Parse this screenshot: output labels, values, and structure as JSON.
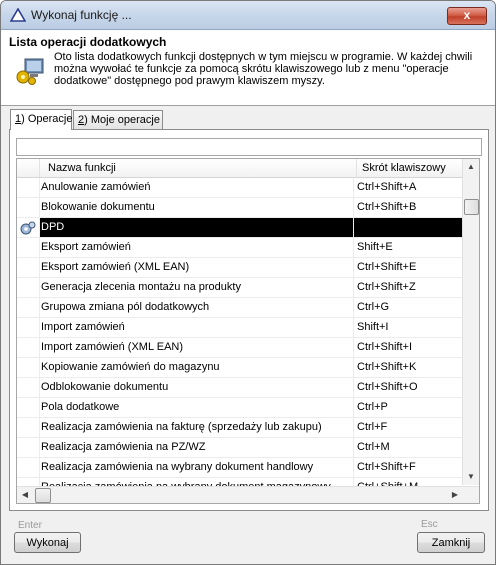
{
  "window": {
    "title": "Wykonaj funkcję ...",
    "close_label": "x"
  },
  "header": {
    "title": "Lista operacji dodatkowych",
    "description": "Oto lista dodatkowych funkcji dostępnych w tym miejscu w programie. W każdej chwili można wywołać te funkcje za pomocą skrótu klawiszowego lub z menu \"operacje dodatkowe\" dostępnego pod prawym klawiszem myszy."
  },
  "tabs": [
    {
      "hotkey": "1",
      "label": ") Operacje"
    },
    {
      "hotkey": "2",
      "label": ") Moje operacje"
    }
  ],
  "grid": {
    "columns": [
      "Nazwa funkcji",
      "Skrót klawiszowy"
    ],
    "rows": [
      {
        "name": "Anulowanie zamówień",
        "key": "Ctrl+Shift+A"
      },
      {
        "name": "Blokowanie dokumentu",
        "key": "Ctrl+Shift+B"
      },
      {
        "name": "DPD",
        "key": ""
      },
      {
        "name": "Eksport zamówień",
        "key": "Shift+E"
      },
      {
        "name": "Eksport zamówień (XML EAN)",
        "key": "Ctrl+Shift+E"
      },
      {
        "name": "Generacja zlecenia montażu na produkty",
        "key": "Ctrl+Shift+Z"
      },
      {
        "name": "Grupowa zmiana pól dodatkowych",
        "key": "Ctrl+G"
      },
      {
        "name": "Import zamówień",
        "key": "Shift+I"
      },
      {
        "name": "Import zamówień (XML EAN)",
        "key": "Ctrl+Shift+I"
      },
      {
        "name": "Kopiowanie zamówień do magazynu",
        "key": "Ctrl+Shift+K"
      },
      {
        "name": "Odblokowanie dokumentu",
        "key": "Ctrl+Shift+O"
      },
      {
        "name": "Pola dodatkowe",
        "key": "Ctrl+P"
      },
      {
        "name": "Realizacja zamówienia na fakturę (sprzedaży lub zakupu)",
        "key": "Ctrl+F"
      },
      {
        "name": "Realizacja zamówienia na PZ/WZ",
        "key": "Ctrl+M"
      },
      {
        "name": "Realizacja zamówienia na wybrany dokument handlowy",
        "key": "Ctrl+Shift+F"
      },
      {
        "name": "Realizacja zamówienia na wybrany dokument magazynowy",
        "key": "Ctrl+Shift+M"
      }
    ],
    "selected_row": "DPD"
  },
  "footer": {
    "enter_hint": "Enter",
    "execute_label": "Wykonaj",
    "esc_hint": "Esc",
    "close_label": "Zamknij"
  },
  "colors": {
    "title_bar": "#c7d6ea",
    "selection": "#000000",
    "close_button": "#c0402a"
  }
}
